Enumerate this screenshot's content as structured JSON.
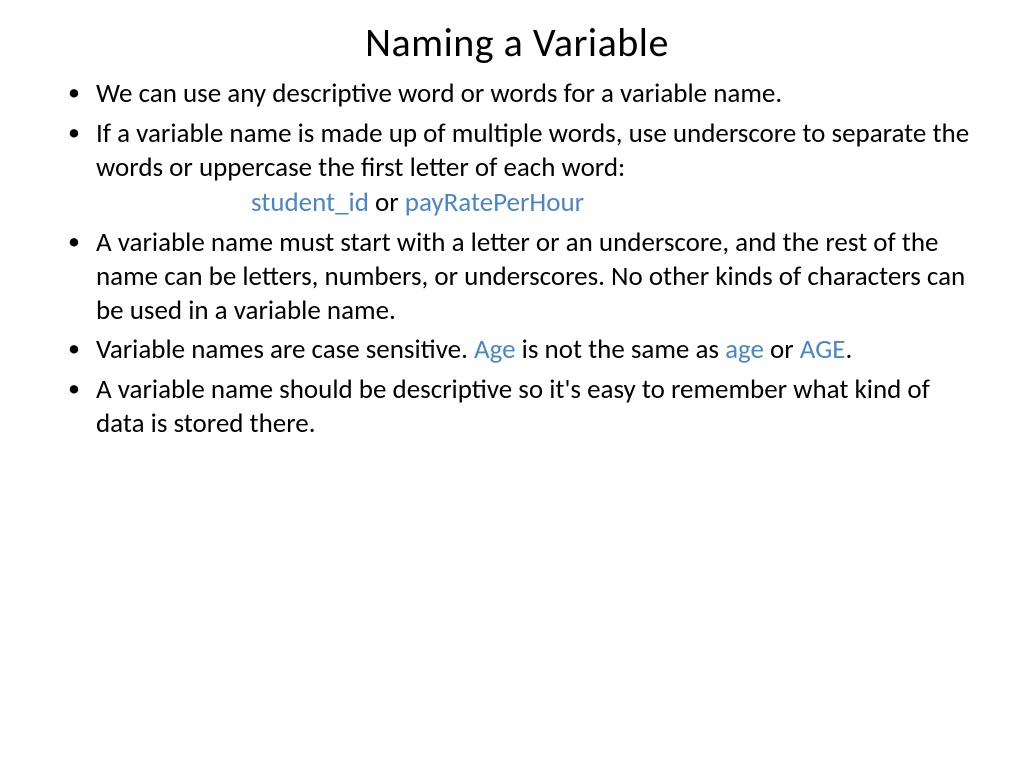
{
  "title": "Naming a Variable",
  "bullets": {
    "b1": "We can use any descriptive word or words for a variable name.",
    "b2": {
      "text": "If a variable name is made up of multiple words, use underscore to separate the words or uppercase the first letter of each word:",
      "code1": "student_id",
      "sep": "   or   ",
      "code2": "payRatePerHour"
    },
    "b3": "A variable name must start with a letter or an underscore, and the rest of the name can be letters, numbers, or underscores.  No other kinds of characters can be used in a variable name.",
    "b4": {
      "p1": "Variable names are case sensitive.  ",
      "c1": "Age",
      "p2": " is not the same as ",
      "c2": "age",
      "p3": " or ",
      "c3": "AGE",
      "p4": "."
    },
    "b5": "A variable name should be descriptive so it's easy to remember what kind of data is stored there."
  }
}
